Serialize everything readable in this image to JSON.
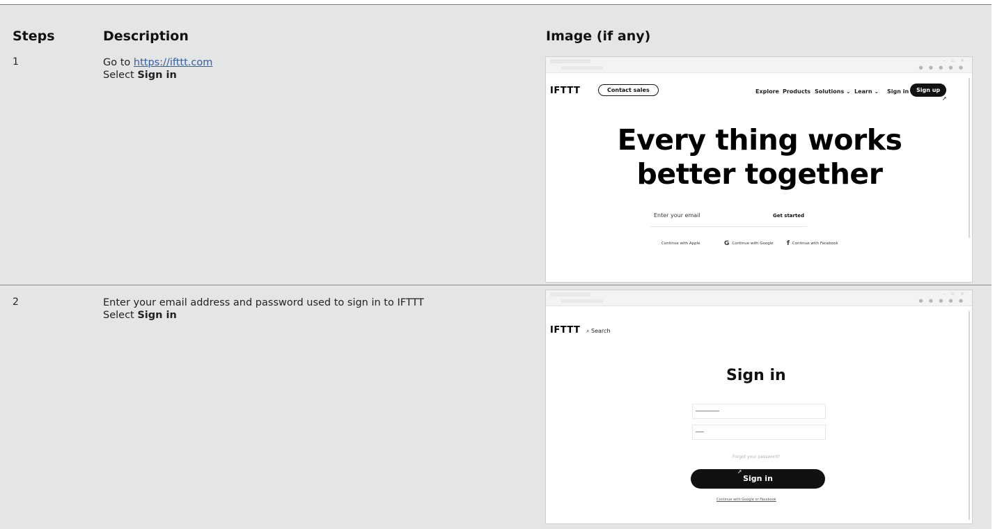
{
  "table": {
    "headers": {
      "steps": "Steps",
      "description": "Description",
      "image": "Image (if any)"
    }
  },
  "rows": [
    {
      "step": "1",
      "desc_prefix": "Go to ",
      "desc_link": "https://ifttt.com",
      "desc_line2_prefix": "Select ",
      "desc_line2_bold": "Sign in"
    },
    {
      "step": "2",
      "desc_line1": "Enter your email address and password used to sign in to IFTTT",
      "desc_line2_prefix": "Select ",
      "desc_line2_bold": "Sign in"
    }
  ],
  "shot1": {
    "logo": "IFTTT",
    "contact_sales": "Contact sales",
    "nav": [
      "Explore",
      "Products",
      "Solutions ⌄",
      "Learn ⌄",
      "Sign in"
    ],
    "sign_up": "Sign up",
    "hero_line1": "Every thing works",
    "hero_line2": "better together",
    "email_placeholder": "Enter your email",
    "get_started": "Get started",
    "continue_apple": "Continue with Apple",
    "continue_google": "Continue with Google",
    "continue_facebook": "Continue with Facebook"
  },
  "shot2": {
    "logo": "IFTTT",
    "search": "Search",
    "title": "Sign in",
    "forgot": "Forgot your password?",
    "button": "Sign in",
    "continue_link": "Continue with Google or Facebook"
  },
  "icons": {
    "apple": "apple-icon",
    "google": "google-icon",
    "facebook": "facebook-icon",
    "search": "search-icon",
    "cursor": "cursor-icon"
  }
}
